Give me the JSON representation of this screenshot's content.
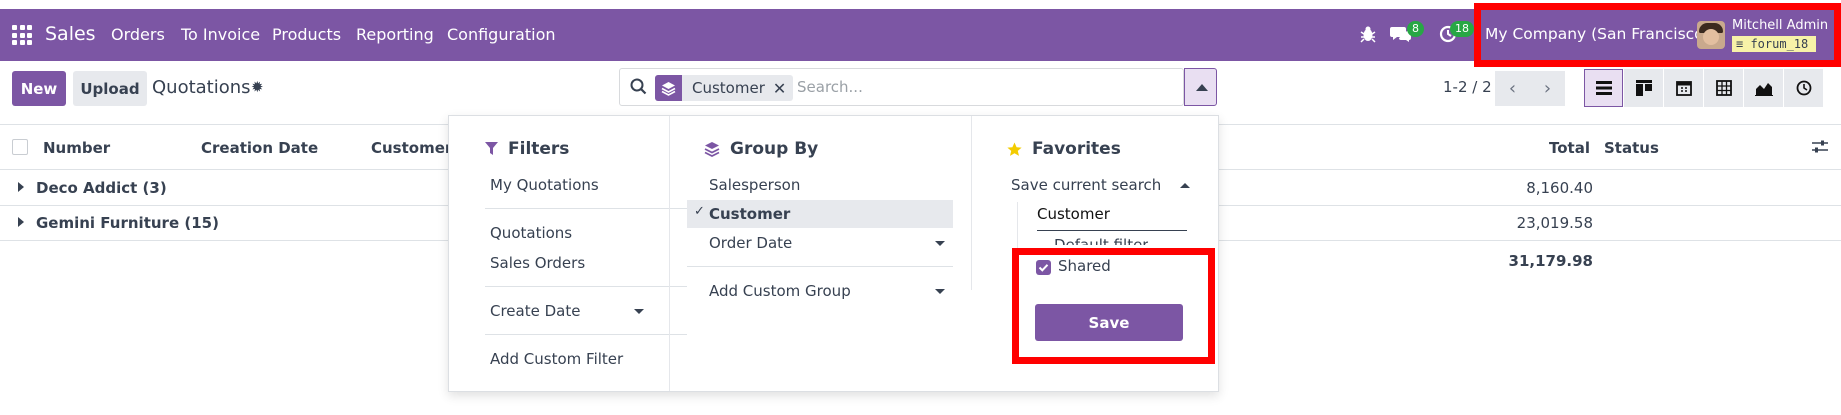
{
  "navbar": {
    "app_name": "Sales",
    "menu": [
      "Orders",
      "To Invoice",
      "Products",
      "Reporting",
      "Configuration"
    ],
    "messages_count": "8",
    "activities_count": "18",
    "company": "My Company (San Francisco)",
    "user_name": "Mitchell Admin",
    "database": "forum_18"
  },
  "control": {
    "new_label": "New",
    "upload_label": "Upload",
    "breadcrumb": "Quotations",
    "search": {
      "facet": "Customer",
      "placeholder": "Search..."
    },
    "pager": "1-2 / 2"
  },
  "table": {
    "headers": [
      "Number",
      "Creation Date",
      "Customer",
      "Total",
      "Status"
    ],
    "groups": [
      {
        "label": "Deco Addict (3)",
        "total": "8,160.40"
      },
      {
        "label": "Gemini Furniture (15)",
        "total": "23,019.58"
      }
    ],
    "grand_total": "31,179.98"
  },
  "dropdown": {
    "filters": {
      "title": "Filters",
      "items": [
        "My Quotations",
        "Quotations",
        "Sales Orders",
        "Create Date",
        "Add Custom Filter"
      ]
    },
    "group_by": {
      "title": "Group By",
      "items": [
        "Salesperson",
        "Customer",
        "Order Date",
        "Add Custom Group"
      ],
      "selected": "Customer"
    },
    "favorites": {
      "title": "Favorites",
      "save_current_search": "Save current search",
      "name_value": "Customer",
      "default_filter_label": "Default filter",
      "shared_label": "Shared",
      "shared_checked": true,
      "save_label": "Save"
    }
  },
  "colors": {
    "brand": "#7c56a4",
    "highlight": "#ff0000",
    "badge": "#28a745"
  }
}
